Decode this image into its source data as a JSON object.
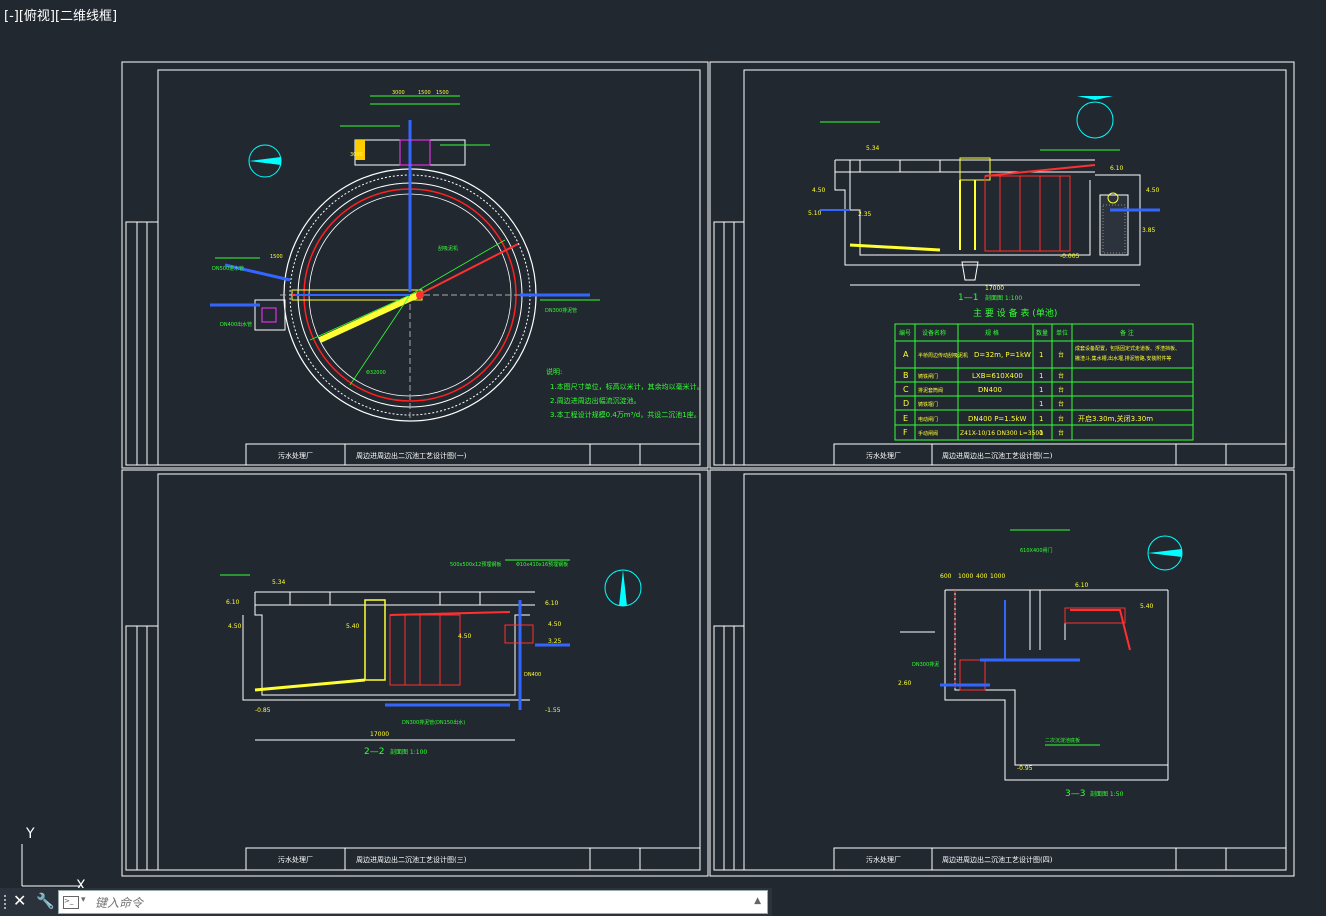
{
  "viewport": {
    "label": "[-][俯视][二维线框]"
  },
  "ucs": {
    "y_label": "Y",
    "x_label": "X"
  },
  "command": {
    "placeholder": "键入命令",
    "prompt_icon": ">_"
  },
  "sheets": {
    "s1": {
      "title_left": "污水处理厂",
      "title_mid": "周边进周边出二沉池工艺设计图(一)",
      "notes_title": "说明:",
      "notes": [
        "1.本图尺寸单位，标高以米计，其余均以毫米计。",
        "2.周边进周边出幅流沉淀池。",
        "3.本工程设计规模0.4万m³/d，共设二沉池1座。"
      ],
      "dims": [
        "3000",
        "1500",
        "1500",
        "3000",
        "1500"
      ],
      "labels": [
        "DN500进水管",
        "DN400出水管",
        "Φ32000",
        "刮吸泥机",
        "DN300排泥管"
      ]
    },
    "s2": {
      "title_left": "污水处理厂",
      "title_mid": "周边进周边出二沉池工艺设计图(二)",
      "section_label": "1—1",
      "section_sub": "剖面图 1:100",
      "elev": [
        "5.34",
        "4.50",
        "5.10",
        "2.35",
        "6.10",
        "4.50",
        "3.85",
        "-0.005"
      ],
      "dims": [
        "17000"
      ],
      "table_title": "主 要 设 备 表 (单池)",
      "table_headers": [
        "编号",
        "设备名称",
        "规 格",
        "数量",
        "单位",
        "备 注"
      ],
      "table_rows": [
        [
          "A",
          "半桥周边传动刮吸泥机",
          "D=32m, P=1kW",
          "1",
          "台",
          "成套设备配置，包括固定式走道板、浮渣挡板、"
        ],
        [
          "",
          "",
          "",
          "",
          "",
          "撇渣斗,集水槽,出水堰,排泥管路,安装附件等"
        ],
        [
          "B",
          "铸铁闸门",
          "LXB=610X400",
          "1",
          "台",
          ""
        ],
        [
          "C",
          "排泥套筒阀",
          "DN400",
          "1",
          "台",
          ""
        ],
        [
          "D",
          "铸铁堰门",
          "",
          "1",
          "台",
          ""
        ],
        [
          "E",
          "电动闸门",
          "DN400 P=1.5kW",
          "1",
          "台",
          "开启3.30m,关闭3.30m"
        ],
        [
          "F",
          "手动闸阀",
          "Z41X-10/16 DN300 L=3500",
          "1",
          "台",
          ""
        ]
      ]
    },
    "s3": {
      "title_left": "污水处理厂",
      "title_mid": "周边进周边出二沉池工艺设计图(三)",
      "section_label": "2—2",
      "section_sub": "剖面图 1:100",
      "elev": [
        "5.34",
        "6.10",
        "4.50",
        "5.40",
        "4.50",
        "3.25",
        "-0.85",
        "-1.55",
        "6.10",
        "4.50"
      ],
      "dims": [
        "17000",
        "500x500x12预埋钢板",
        "Φ10x410x16预埋钢板",
        "DN400"
      ],
      "labels": [
        "DN300排泥管(DN150出水)"
      ]
    },
    "s4": {
      "title_left": "污水处理厂",
      "title_mid": "周边进周边出二沉池工艺设计图(四)",
      "section_label": "3—3",
      "section_sub": "剖面图 1:50",
      "elev": [
        "6.10",
        "5.40",
        "2.60",
        "-0.95"
      ],
      "dims": [
        "600",
        "1000",
        "400",
        "1000",
        "610X400闸门"
      ],
      "labels": [
        "DN300排泥",
        "二次沉淀池底板"
      ]
    }
  }
}
